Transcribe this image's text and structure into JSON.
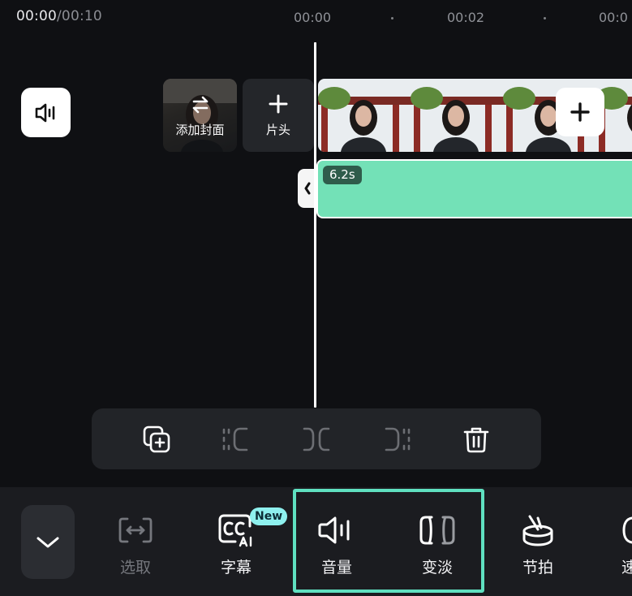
{
  "time": {
    "current": "00:00",
    "total": "/00:10"
  },
  "ruler": {
    "ticks": [
      "00:00",
      "00:02",
      "00:0"
    ]
  },
  "timeline": {
    "cover_label": "添加封面",
    "header_label": "片头",
    "audio_duration": "6.2s"
  },
  "clip_toolbar": {
    "items": [
      "duplicate-icon",
      "trim-start-icon",
      "split-icon",
      "trim-end-icon",
      "delete-icon"
    ]
  },
  "bottom_tools": {
    "select": "选取",
    "subtitles": "字幕",
    "subtitles_badge": "New",
    "volume": "音量",
    "fade": "变淡",
    "beat": "节拍",
    "speed_partial": "速"
  },
  "colors": {
    "background": "#0f1013",
    "audio_clip": "#73e1b7",
    "highlight": "#5fe0c0",
    "new_badge": "#8ef0ee"
  }
}
